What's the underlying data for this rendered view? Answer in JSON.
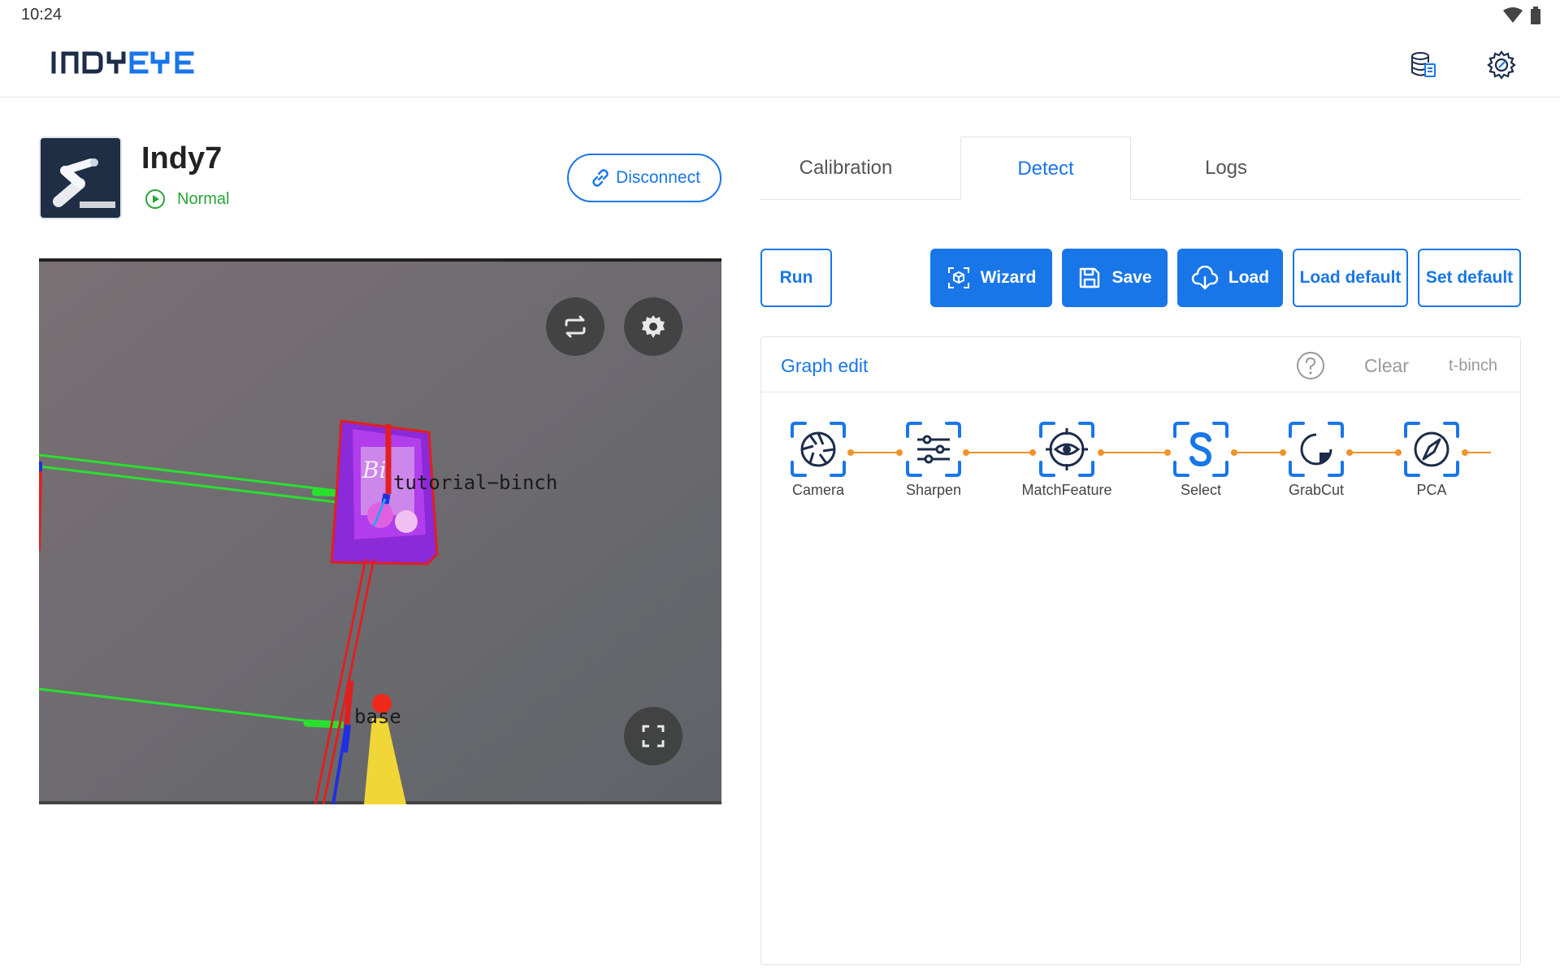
{
  "status_bar": {
    "time": "10:24"
  },
  "header": {
    "app_name": "INDYEYE"
  },
  "robot": {
    "name": "Indy7",
    "status": "Normal"
  },
  "disconnect_label": "Disconnect",
  "camera": {
    "overlay_label_object": "tutorial−binch",
    "overlay_label_base": "base"
  },
  "tabs": [
    {
      "label": "Calibration",
      "active": false
    },
    {
      "label": "Detect",
      "active": true
    },
    {
      "label": "Logs",
      "active": false
    }
  ],
  "toolbar": {
    "run": "Run",
    "wizard": "Wizard",
    "save": "Save",
    "load": "Load",
    "load_default": "Load default",
    "set_default": "Set default"
  },
  "graph": {
    "title": "Graph edit",
    "clear": "Clear",
    "profile": "t-binch",
    "nodes": [
      {
        "label": "Camera",
        "icon": "camera-aperture-icon"
      },
      {
        "label": "Sharpen",
        "icon": "sliders-icon"
      },
      {
        "label": "MatchFeature",
        "icon": "eye-target-icon"
      },
      {
        "label": "Select",
        "icon": "select-s-icon"
      },
      {
        "label": "GrabCut",
        "icon": "grabcut-icon"
      },
      {
        "label": "PCA",
        "icon": "compass-icon"
      }
    ]
  },
  "colors": {
    "accent": "#1976e8",
    "status_ok": "#27a536",
    "connector": "#f0932b"
  }
}
